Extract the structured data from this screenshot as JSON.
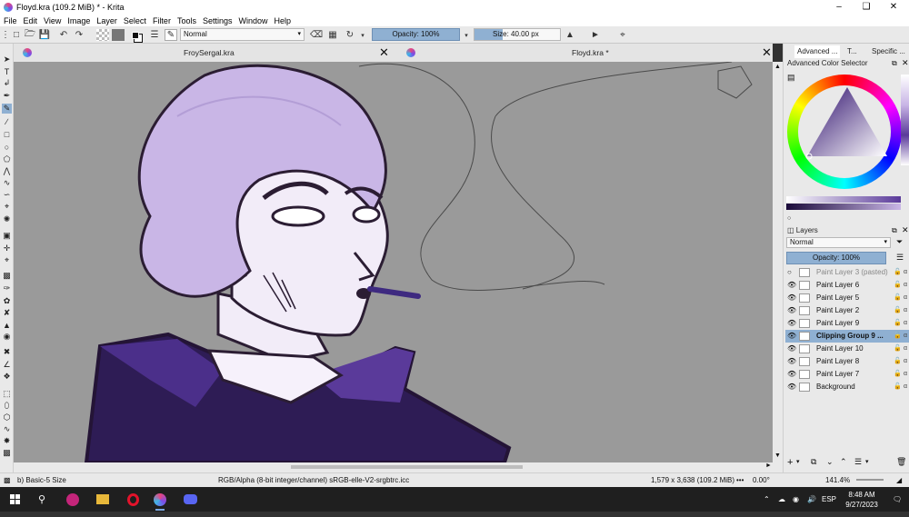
{
  "window": {
    "title": "Floyd.kra (109.2 MiB) * - Krita"
  },
  "menu": [
    "File",
    "Edit",
    "View",
    "Image",
    "Layer",
    "Select",
    "Filter",
    "Tools",
    "Settings",
    "Window",
    "Help"
  ],
  "toolbar": {
    "blend_mode": "Normal",
    "opacity": "Opacity: 100%",
    "size": "Size: 40.00 px"
  },
  "tabs": [
    {
      "label": "FroySergal.kra"
    },
    {
      "label": "Floyd.kra *"
    }
  ],
  "dock": {
    "tabs": [
      "Advanced ...",
      "T...",
      "Specific ..."
    ],
    "color_selector_title": "Advanced Color Selector",
    "layers_title": "Layers",
    "layers_blend": "Normal",
    "layers_opacity": "Opacity:  100%",
    "layers": [
      {
        "name": "Paint Layer 3 (pasted)",
        "selected": false,
        "faded": true
      },
      {
        "name": "Paint Layer 6",
        "selected": false
      },
      {
        "name": "Paint Layer 5",
        "selected": false
      },
      {
        "name": "Paint Layer 2",
        "selected": false
      },
      {
        "name": "Paint Layer 9",
        "selected": false
      },
      {
        "name": "Clipping Group 9 ...",
        "selected": true
      },
      {
        "name": "Paint Layer 10",
        "selected": false
      },
      {
        "name": "Paint Layer 8",
        "selected": false
      },
      {
        "name": "Paint Layer 7",
        "selected": false
      },
      {
        "name": "Background",
        "selected": false
      }
    ]
  },
  "status": {
    "brush": "b) Basic-5 Size",
    "color_model": "RGB/Alpha (8-bit integer/channel)  sRGB-elle-V2-srgbtrc.icc",
    "image_size": "1,579 x 3,638 (109.2 MiB)",
    "rotation": "0.00°",
    "zoom": "141.4%"
  },
  "taskbar": {
    "time": "8:48 AM",
    "date": "9/27/2023",
    "lang": "ESP"
  },
  "colors": {
    "accent": "#8fb0d2",
    "hair": "#c9b6e6",
    "skin": "#f2ecf8",
    "coat": "#3a2466",
    "collar": "#5a3a9a",
    "canvas_bg": "#9a9a9a"
  }
}
